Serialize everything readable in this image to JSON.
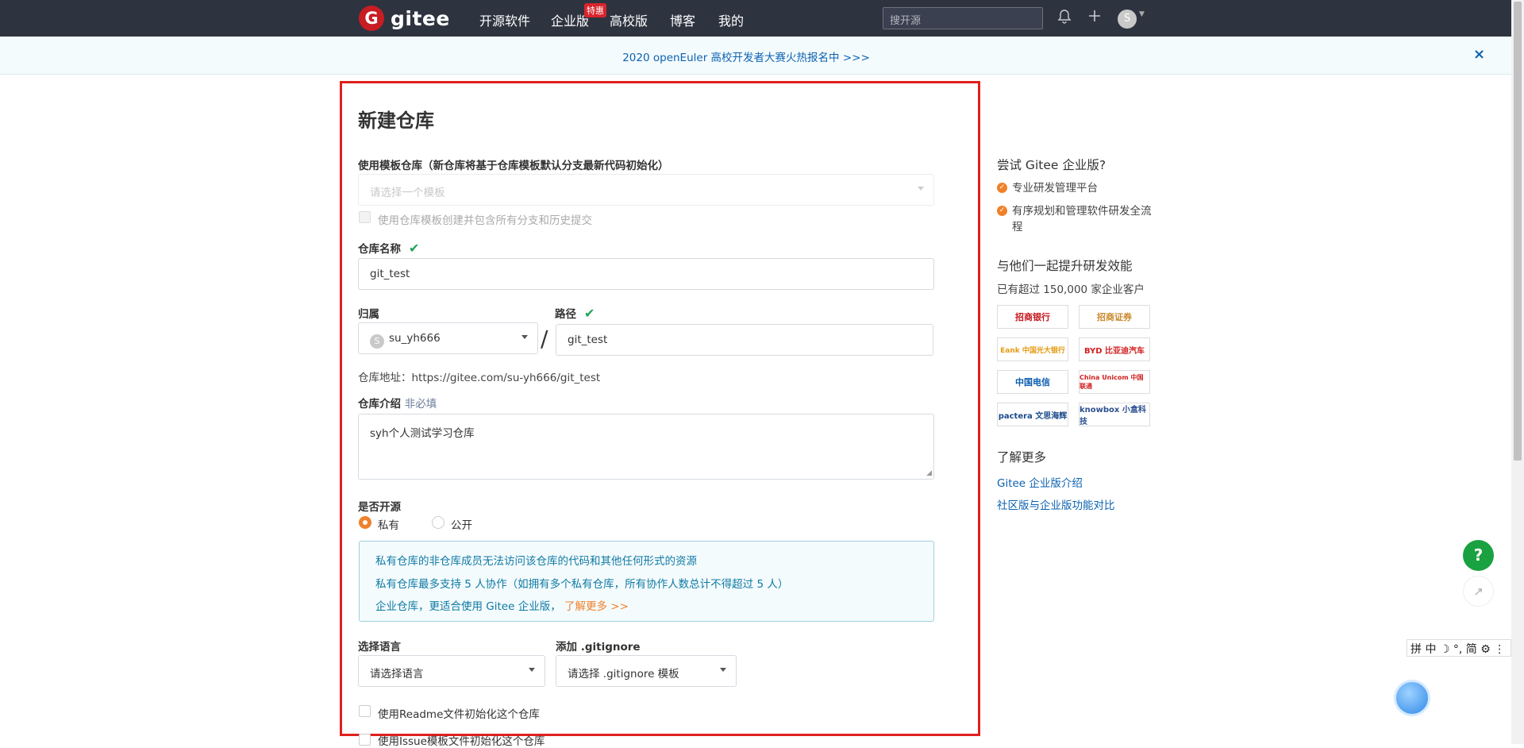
{
  "topnav": {
    "logo_text": "gitee",
    "logo_mark": "G",
    "items": [
      "开源软件",
      "企业版",
      "高校版",
      "博客",
      "我的"
    ],
    "enterprise_badge": "特惠",
    "search_placeholder": "搜开源",
    "avatar_letter": "S"
  },
  "banner": {
    "text": "2020 openEuler 高校开发者大赛火热报名中 >>>",
    "close": "×"
  },
  "form": {
    "title": "新建仓库",
    "template_label": "使用模板仓库（新仓库将基于仓库模板默认分支最新代码初始化）",
    "template_placeholder": "请选择一个模板",
    "template_checkbox": "使用仓库模板创建并包含所有分支和历史提交",
    "name_label": "仓库名称",
    "name_value": "git_test",
    "owner_label": "归属",
    "owner_value": "su_yh666",
    "owner_avatar": "S",
    "path_label": "路径",
    "path_value": "git_test",
    "slash": "/",
    "address": "仓库地址：https://gitee.com/su-yh666/git_test",
    "desc_label": "仓库介绍",
    "desc_optional": "非必填",
    "desc_value": "syh个人测试学习仓库",
    "open_label": "是否开源",
    "private_label": "私有",
    "public_label": "公开",
    "selected_visibility": "私有",
    "info_lines": [
      "私有仓库的非仓库成员无法访问该仓库的代码和其他任何形式的资源",
      "私有仓库最多支持 5 人协作（如拥有多个私有仓库，所有协作人数总计不得超过 5 人）",
      "企业仓库，更适合使用 Gitee 企业版，"
    ],
    "info_link": "了解更多 >>",
    "lang_label": "选择语言",
    "lang_value": "请选择语言",
    "gitignore_label": "添加 .gitignore",
    "gitignore_value": "请选择 .gitignore 模板",
    "readme_checkbox": "使用Readme文件初始化这个仓库",
    "issue_checkbox": "使用Issue模板文件初始化这个仓库"
  },
  "sidebar": {
    "try_title": "尝试 Gitee 企业版?",
    "try_items": [
      "专业研发管理平台",
      "有序规划和管理软件研发全流程"
    ],
    "together_title": "与他们一起提升研发效能",
    "customers": "已有超过 150,000 家企业客户",
    "logos": [
      "招商银行",
      "招商证券",
      "Eank 中国光大银行",
      "BYD 比亚迪汽车",
      "中国电信",
      "China Unicom 中国联通",
      "pactera 文思海辉",
      "knowbox 小盒科技"
    ],
    "learn_title": "了解更多",
    "links": [
      "Gitee 企业版介绍",
      "社区版与企业版功能对比"
    ]
  },
  "floats": {
    "help": "?",
    "ime": "拼 中 ☽ °, 简 ⚙ ⋮"
  },
  "colors": {
    "topbar": "#2e3340",
    "accent_orange": "#f0812a",
    "highlight_red": "#e0201c",
    "link_blue": "#0c62b1",
    "success_green": "#21a356"
  }
}
